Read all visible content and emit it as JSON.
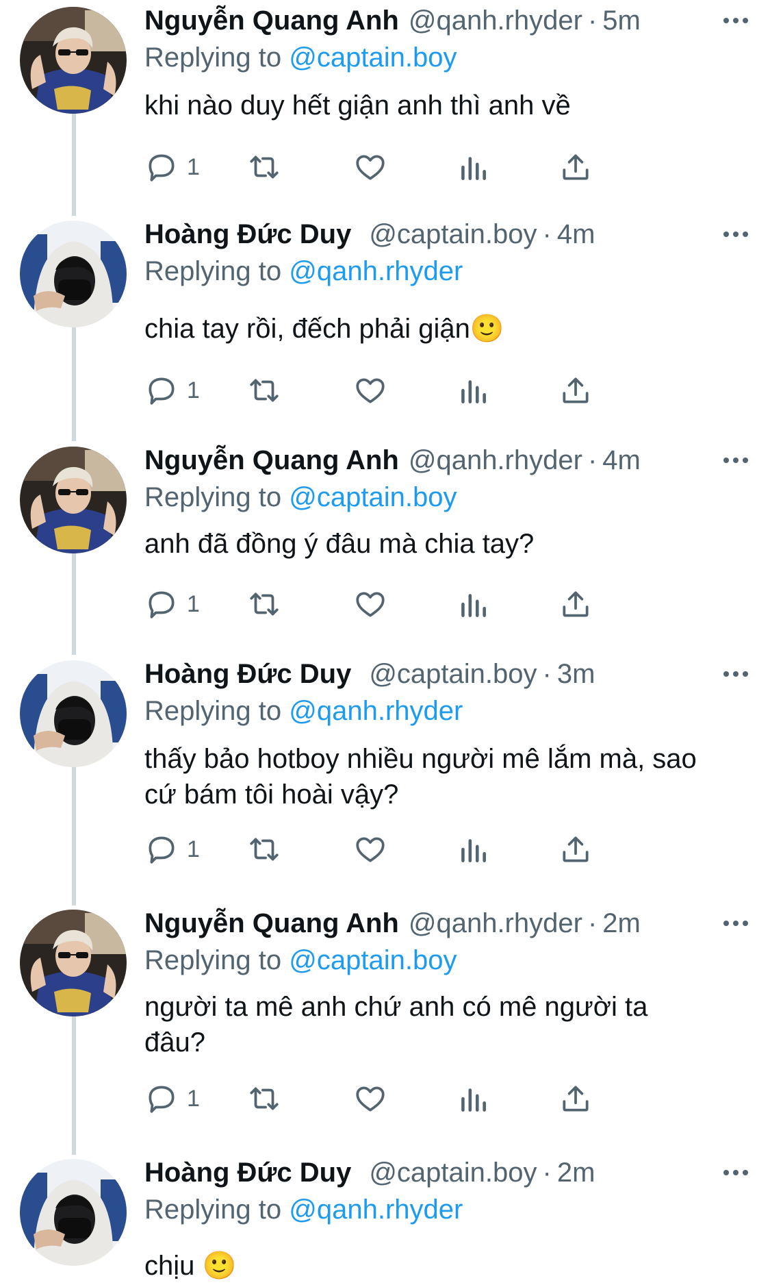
{
  "replying_label": "Replying to",
  "tweets": [
    {
      "name": "Nguyễn Quang Anh",
      "handle": "@qanh.rhyder",
      "separator": "·",
      "time": "5m",
      "replying_to": "@captain.boy",
      "text": "khi nào duy hết giận anh thì anh về",
      "reply_count": "1",
      "avatar_icon": "avatar-photo-blond-sunglasses"
    },
    {
      "name": "Hoàng Đức Duy",
      "handle": "@captain.boy",
      "separator": "·",
      "time": "4m",
      "replying_to": "@qanh.rhyder",
      "text": "chia tay rồi, đếch phải giận🙂",
      "reply_count": "1",
      "avatar_icon": "avatar-photo-white-hood-mask"
    },
    {
      "name": "Nguyễn Quang Anh",
      "handle": "@qanh.rhyder",
      "separator": "·",
      "time": "4m",
      "replying_to": "@captain.boy",
      "text": "anh đã đồng ý đâu mà chia tay?",
      "reply_count": "1",
      "avatar_icon": "avatar-photo-blond-sunglasses"
    },
    {
      "name": "Hoàng Đức Duy",
      "handle": "@captain.boy",
      "separator": "·",
      "time": "3m",
      "replying_to": "@qanh.rhyder",
      "text": "thấy bảo hotboy nhiều người mê lắm mà, sao cứ bám tôi hoài vậy?",
      "reply_count": "1",
      "avatar_icon": "avatar-photo-white-hood-mask"
    },
    {
      "name": "Nguyễn Quang Anh",
      "handle": "@qanh.rhyder",
      "separator": "·",
      "time": "2m",
      "replying_to": "@captain.boy",
      "text": "người ta mê anh chứ anh có mê người ta đâu?",
      "reply_count": "1",
      "avatar_icon": "avatar-photo-blond-sunglasses"
    },
    {
      "name": "Hoàng Đức Duy",
      "handle": "@captain.boy",
      "separator": "·",
      "time": "2m",
      "replying_to": "@qanh.rhyder",
      "text": "chịu 🙂",
      "reply_count": "",
      "avatar_icon": "avatar-photo-white-hood-mask"
    }
  ],
  "colors": {
    "link": "#1d9bf0",
    "secondary_text": "#536471",
    "primary_text": "#0f1419",
    "thread_line": "#cfd9de"
  },
  "action_icons": [
    "reply-icon",
    "retweet-icon",
    "like-icon",
    "analytics-icon",
    "share-icon"
  ]
}
